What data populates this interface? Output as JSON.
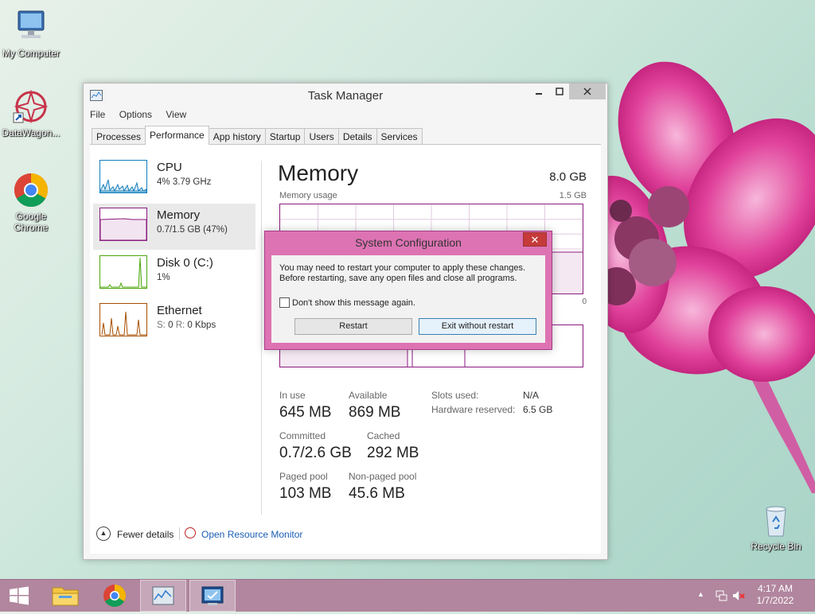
{
  "desktop": {
    "icons": [
      {
        "label": "My Computer",
        "icon": "computer-icon"
      },
      {
        "label": "DataWagon...",
        "icon": "datawagon-icon"
      },
      {
        "label": "Google Chrome",
        "icon": "chrome-icon"
      },
      {
        "label": "Recycle Bin",
        "icon": "recycle-bin-icon"
      }
    ]
  },
  "task_manager": {
    "title": "Task Manager",
    "menu": [
      "File",
      "Options",
      "View"
    ],
    "tabs": [
      "Processes",
      "Performance",
      "App history",
      "Startup",
      "Users",
      "Details",
      "Services"
    ],
    "active_tab": "Performance",
    "perf_items": [
      {
        "name": "CPU",
        "value": "4% 3.79 GHz",
        "color": "#117dbb"
      },
      {
        "name": "Memory",
        "value": "0.7/1.5 GB (47%)",
        "color": "#8b1a7f"
      },
      {
        "name": "Disk 0 (C:)",
        "value": "1%",
        "color": "#4da60c"
      },
      {
        "name": "Ethernet",
        "value_prefix_s": "S:",
        "value_s": "0",
        "value_prefix_r": "R:",
        "value_r": "0 Kbps",
        "color": "#a74f01"
      }
    ],
    "memory": {
      "title": "Memory",
      "total": "8.0 GB",
      "usage_label": "Memory usage",
      "usage_max": "1.5 GB",
      "graph_min": "0",
      "stats": {
        "in_use_label": "In use",
        "in_use": "645 MB",
        "available_label": "Available",
        "available": "869 MB",
        "committed_label": "Committed",
        "committed": "0.7/2.6 GB",
        "cached_label": "Cached",
        "cached": "292 MB",
        "paged_pool_label": "Paged pool",
        "paged_pool": "103 MB",
        "non_paged_pool_label": "Non-paged pool",
        "non_paged_pool": "45.6 MB",
        "slots_used_label": "Slots used:",
        "slots_used": "N/A",
        "hw_reserved_label": "Hardware reserved:",
        "hw_reserved": "6.5 GB"
      }
    },
    "footer": {
      "fewer_details": "Fewer details",
      "open_resource_monitor": "Open Resource Monitor"
    }
  },
  "dialog": {
    "title": "System Configuration",
    "message": "You may need to restart your computer to apply these changes. Before restarting, save any open files and close all programs.",
    "checkbox_label": "Don't show this message again.",
    "checkbox_checked": false,
    "restart_label": "Restart",
    "exit_label": "Exit without restart"
  },
  "taskbar": {
    "time": "4:17 AM",
    "date": "1/7/2022"
  },
  "colors": {
    "memory_accent": "#8b1a7f",
    "dialog_frame": "#dd73b3",
    "taskbar": "#b1869e"
  }
}
